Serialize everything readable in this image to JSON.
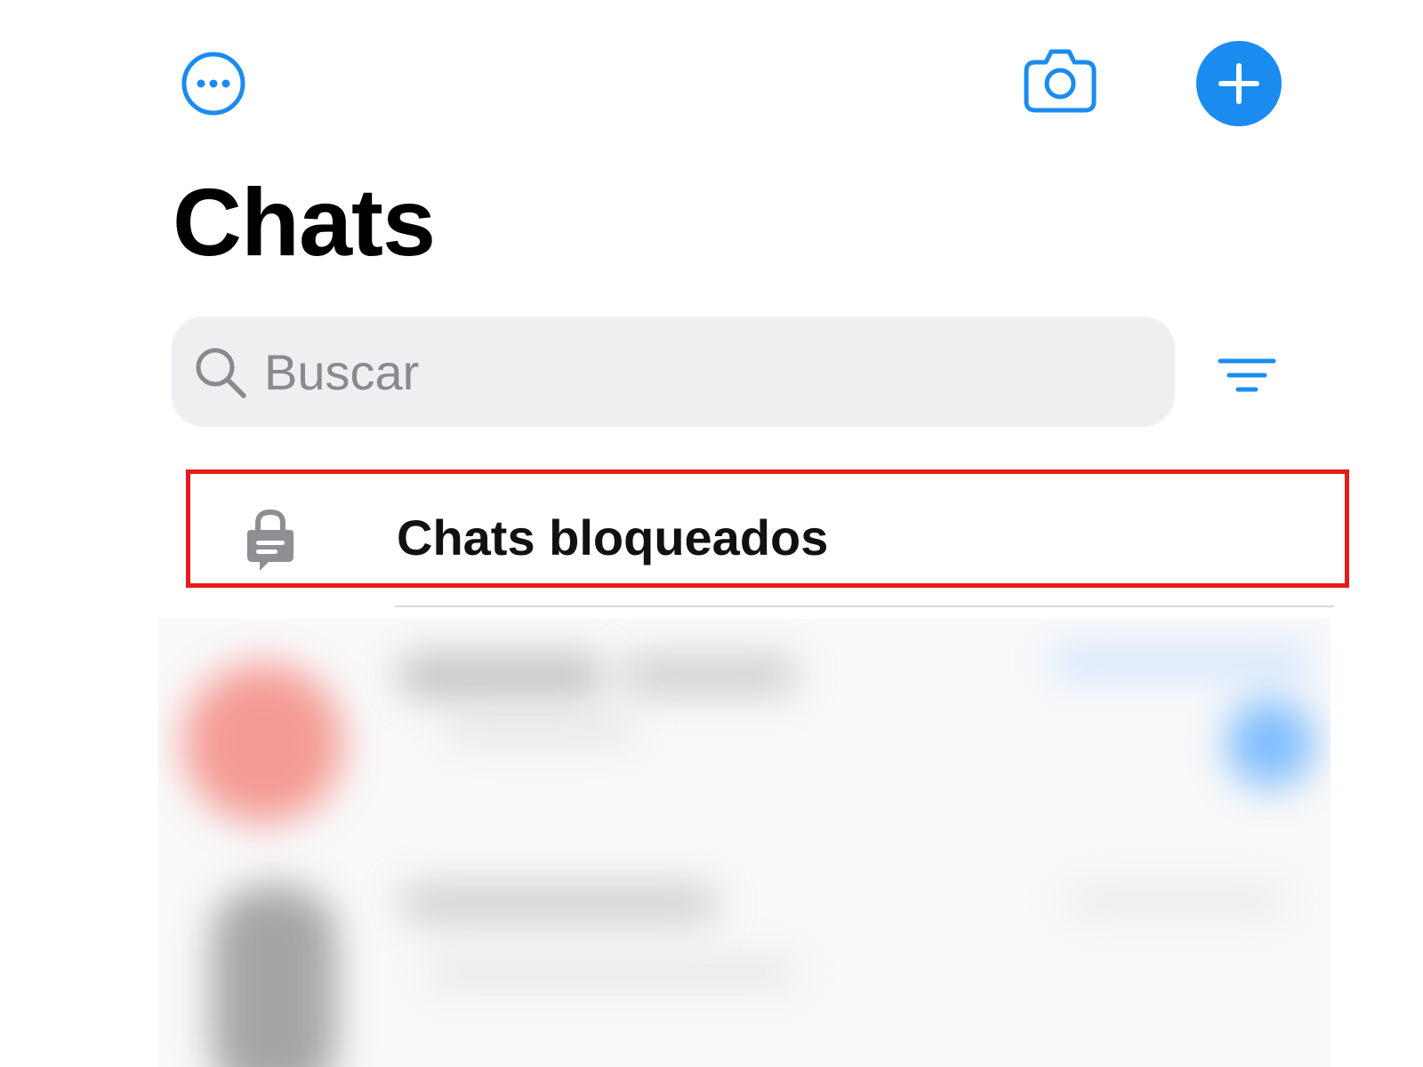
{
  "header": {
    "title": "Chats"
  },
  "search": {
    "placeholder": "Buscar",
    "value": ""
  },
  "locked_chats": {
    "label": "Chats bloqueados"
  },
  "icons": {
    "more": "ellipsis-circle-icon",
    "camera": "camera-icon",
    "new_chat": "plus-icon",
    "search": "magnifying-glass-icon",
    "filter": "filter-icon",
    "locked": "lock-chat-bubble-icon"
  },
  "colors": {
    "accent": "#1a8cf0",
    "search_bg": "#efeff1",
    "placeholder": "#8a8a8e",
    "highlight": "#e41c1c",
    "lock_icon": "#8e8e93"
  }
}
